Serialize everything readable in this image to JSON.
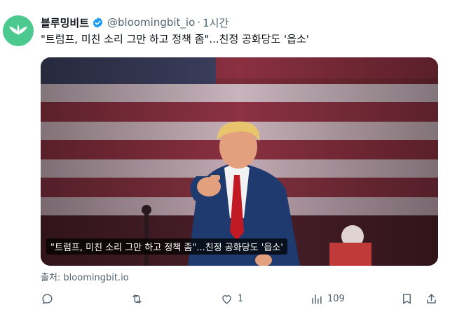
{
  "author": {
    "name": "블루밍비트",
    "handle": "@bloomingbit_io",
    "separator": "·",
    "time": "1시간"
  },
  "colors": {
    "avatar_bg": "#4cc98f",
    "verified": "#1d9bf0",
    "secondary_text": "#536471"
  },
  "tweet": {
    "text": "\"트럼프, 미친 소리 그만 하고 정책 좀\"...친정 공화당도 '읍소'"
  },
  "media": {
    "caption": "\"트럼프, 미친 소리 그만 하고 정책 좀\"...친정 공화당도 '읍소'"
  },
  "link_source": "출처: bloomingbit.io",
  "actions": {
    "reply_count": "",
    "retweet_count": "",
    "like_count": "1",
    "view_count": "109"
  },
  "icons": [
    "logo-icon",
    "verified-icon",
    "more-icon",
    "reply-icon",
    "retweet-icon",
    "like-icon",
    "views-icon",
    "bookmark-icon",
    "share-icon"
  ]
}
